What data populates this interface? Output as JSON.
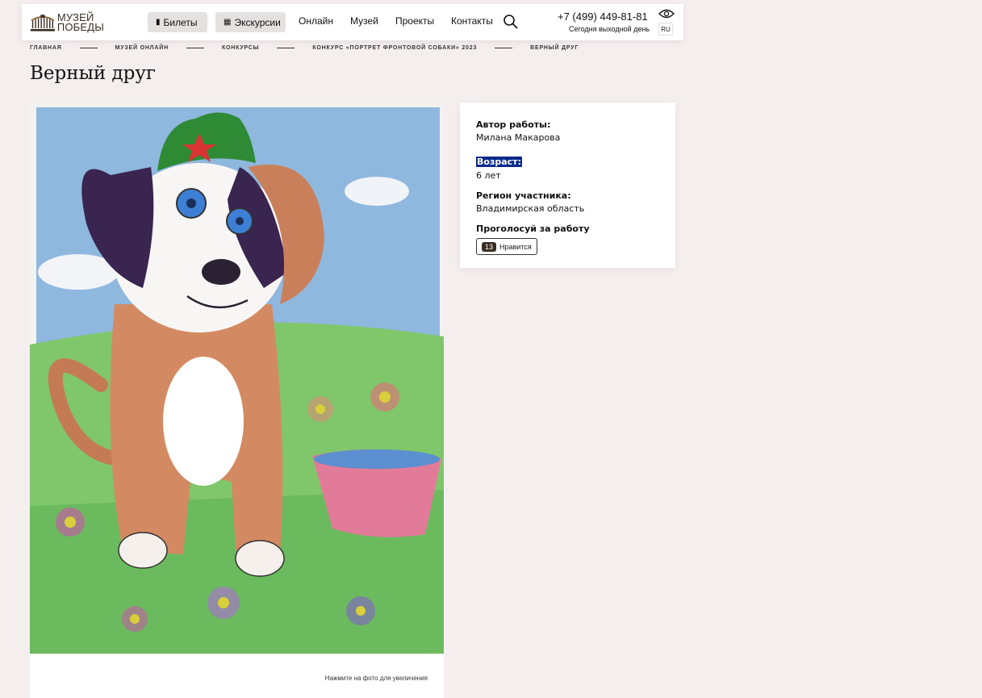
{
  "header": {
    "logo_line1": "МУЗЕЙ",
    "logo_line2": "ПОБЕДЫ",
    "tickets_label": "Билеты",
    "excursions_label": "Экскурсии",
    "nav": [
      "Онлайн",
      "Музей",
      "Проекты",
      "Контакты"
    ],
    "phone": "+7 (499) 449-81-81",
    "status": "Сегодня выходной день",
    "lang": "RU"
  },
  "breadcrumb": [
    "ГЛАВНАЯ",
    "МУЗЕЙ ОНЛАЙН",
    "КОНКУРСЫ",
    "КОНКУРС «ПОРТРЕТ ФРОНТОВОЙ СОБАКИ» 2023",
    "ВЕРНЫЙ ДРУГ"
  ],
  "page_title": "Верный друг",
  "image": {
    "hint": "Нажмите на фото для увеличения"
  },
  "info": {
    "author_label": "Автор работы:",
    "author_value": "Милана Макарова",
    "age_label": "Возраст:",
    "age_value": "6 лет",
    "region_label": "Регион участника:",
    "region_value": "Владимирская область",
    "vote_label": "Проголосуй за работу",
    "like_count": "13",
    "like_label": "Нравится"
  },
  "colors": {
    "background": "#f5eeef",
    "brand_dark": "#3a2e22",
    "selection": "#0a2a8c"
  }
}
